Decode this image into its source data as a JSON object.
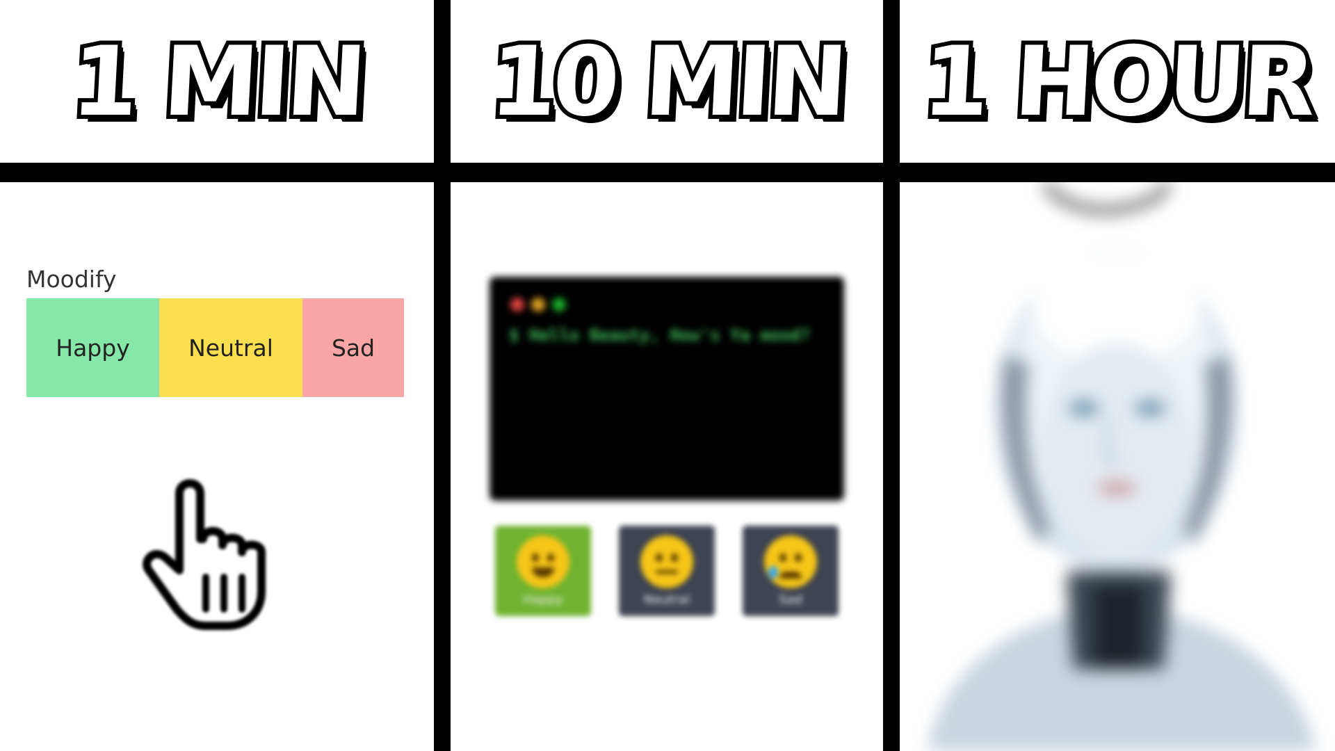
{
  "headers": {
    "col1": "1 MIN",
    "col2": "10 MIN",
    "col3": "1 HOUR"
  },
  "panel1": {
    "app_title": "Moodify",
    "buttons": [
      {
        "label": "Happy",
        "color": "#86e8a8"
      },
      {
        "label": "Neutral",
        "color": "#fcdf4e"
      },
      {
        "label": "Sad",
        "color": "#f9a5a5"
      }
    ],
    "cursor_icon": "hand-pointer-icon"
  },
  "panel2": {
    "terminal": {
      "text": "$ Hello Beauty, How's Ya mood?",
      "text_color": "#3fbf5a",
      "dots": [
        "#e0443e",
        "#dea123",
        "#1aab29"
      ]
    },
    "emoji_buttons": [
      {
        "label": "Happy",
        "icon": "winking-face-icon",
        "bg": "#6fb330"
      },
      {
        "label": "Neutral",
        "icon": "neutral-face-icon",
        "bg": "#3e4451"
      },
      {
        "label": "Sad",
        "icon": "sad-tear-face-icon",
        "bg": "#3e4451"
      }
    ]
  },
  "panel3": {
    "image": "robot-portrait"
  }
}
